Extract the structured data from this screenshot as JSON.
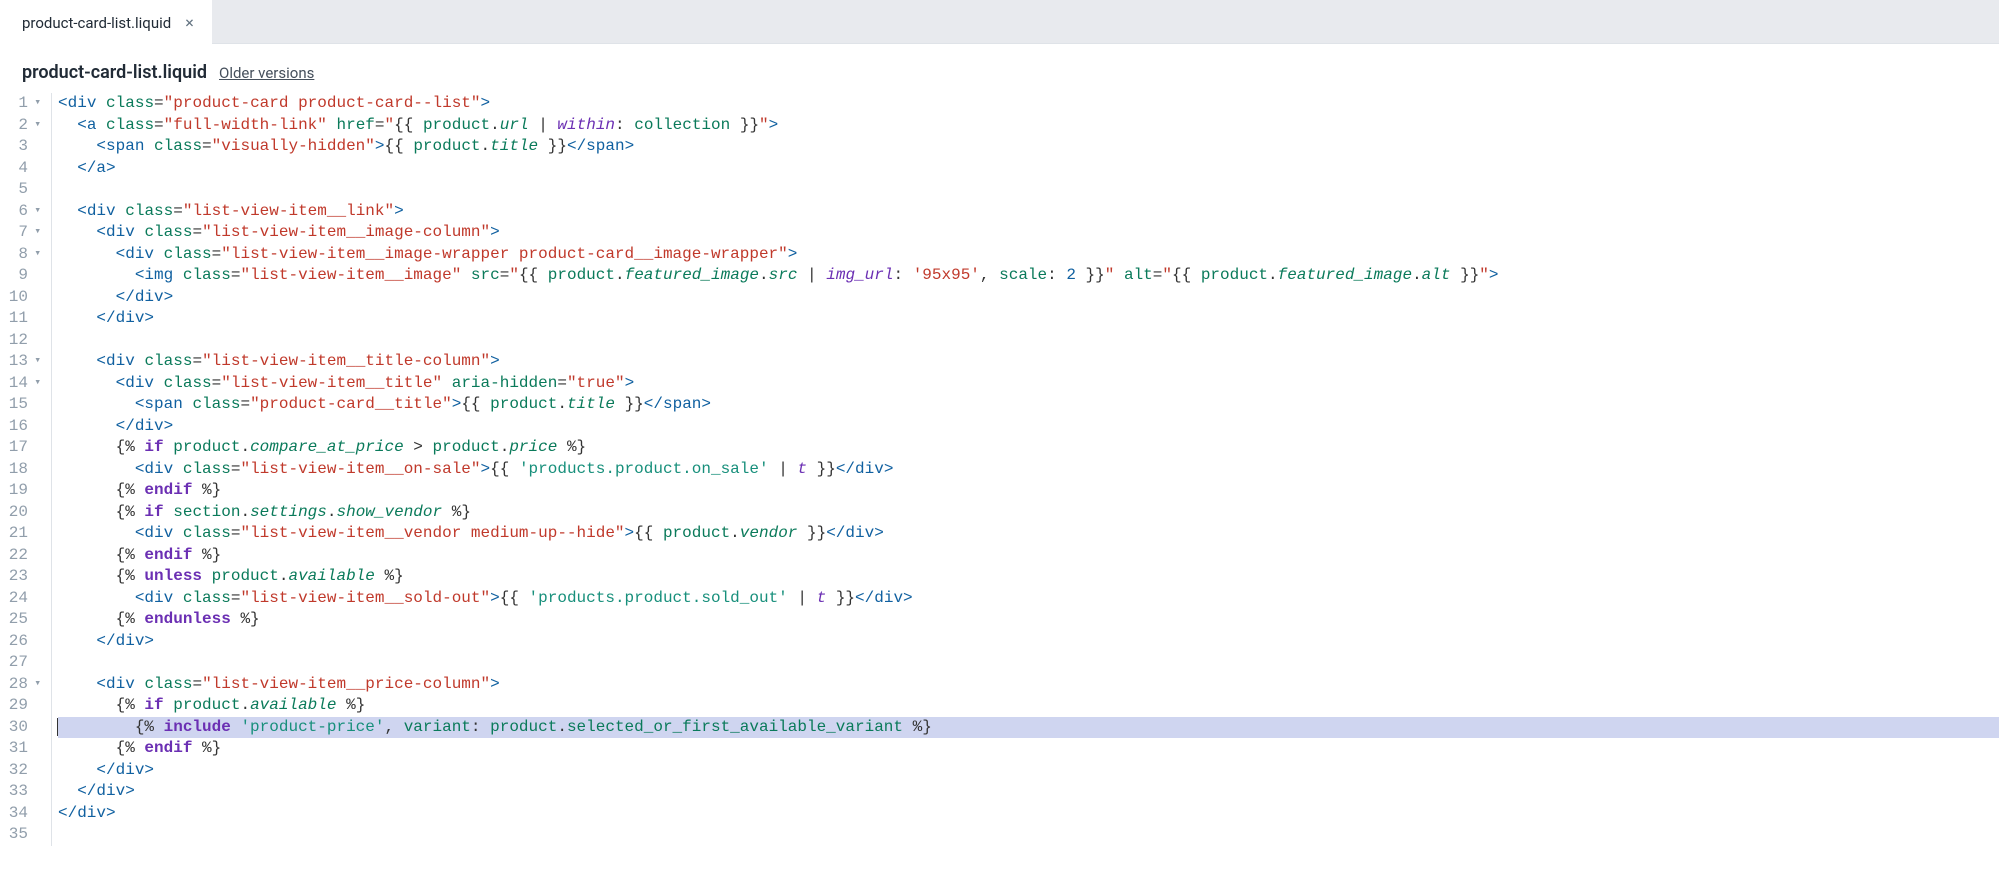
{
  "tab": {
    "label": "product-card-list.liquid"
  },
  "header": {
    "title": "product-card-list.liquid",
    "older": "Older versions"
  },
  "lines": [
    {
      "n": 1,
      "fold": "▾"
    },
    {
      "n": 2,
      "fold": "▾"
    },
    {
      "n": 3,
      "fold": ""
    },
    {
      "n": 4,
      "fold": ""
    },
    {
      "n": 5,
      "fold": ""
    },
    {
      "n": 6,
      "fold": "▾"
    },
    {
      "n": 7,
      "fold": "▾"
    },
    {
      "n": 8,
      "fold": "▾"
    },
    {
      "n": 9,
      "fold": ""
    },
    {
      "n": 10,
      "fold": ""
    },
    {
      "n": 11,
      "fold": ""
    },
    {
      "n": 12,
      "fold": ""
    },
    {
      "n": 13,
      "fold": "▾"
    },
    {
      "n": 14,
      "fold": "▾"
    },
    {
      "n": 15,
      "fold": ""
    },
    {
      "n": 16,
      "fold": ""
    },
    {
      "n": 17,
      "fold": ""
    },
    {
      "n": 18,
      "fold": ""
    },
    {
      "n": 19,
      "fold": ""
    },
    {
      "n": 20,
      "fold": ""
    },
    {
      "n": 21,
      "fold": ""
    },
    {
      "n": 22,
      "fold": ""
    },
    {
      "n": 23,
      "fold": ""
    },
    {
      "n": 24,
      "fold": ""
    },
    {
      "n": 25,
      "fold": ""
    },
    {
      "n": 26,
      "fold": ""
    },
    {
      "n": 27,
      "fold": ""
    },
    {
      "n": 28,
      "fold": "▾"
    },
    {
      "n": 29,
      "fold": ""
    },
    {
      "n": 30,
      "fold": ""
    },
    {
      "n": 31,
      "fold": ""
    },
    {
      "n": 32,
      "fold": ""
    },
    {
      "n": 33,
      "fold": ""
    },
    {
      "n": 34,
      "fold": ""
    },
    {
      "n": 35,
      "fold": ""
    }
  ],
  "code": {
    "l1": [
      [
        "<",
        "br"
      ],
      [
        "div",
        "tag"
      ],
      [
        " ",
        ""
      ],
      [
        "class",
        "attr"
      ],
      [
        "=",
        "eq"
      ],
      [
        "\"product-card product-card--list\"",
        "str"
      ],
      [
        ">",
        "br"
      ]
    ],
    "l2": [
      [
        "  ",
        ""
      ],
      [
        "<",
        "br"
      ],
      [
        "a",
        "tag"
      ],
      [
        " ",
        ""
      ],
      [
        "class",
        "attr"
      ],
      [
        "=",
        "eq"
      ],
      [
        "\"full-width-link\"",
        "str"
      ],
      [
        " ",
        ""
      ],
      [
        "href",
        "attr"
      ],
      [
        "=",
        "eq"
      ],
      [
        "\"",
        "str"
      ],
      [
        "{{ ",
        "ld"
      ],
      [
        "product",
        "var"
      ],
      [
        ".",
        "op"
      ],
      [
        "url",
        "prop"
      ],
      [
        " ",
        "pl"
      ],
      [
        "|",
        "pipe"
      ],
      [
        " ",
        "pl"
      ],
      [
        "within",
        "filt"
      ],
      [
        ": ",
        "pl"
      ],
      [
        "collection",
        "var"
      ],
      [
        " }}",
        "ld"
      ],
      [
        "\"",
        "str"
      ],
      [
        ">",
        "br"
      ]
    ],
    "l3": [
      [
        "    ",
        ""
      ],
      [
        "<",
        "br"
      ],
      [
        "span",
        "tag"
      ],
      [
        " ",
        ""
      ],
      [
        "class",
        "attr"
      ],
      [
        "=",
        "eq"
      ],
      [
        "\"visually-hidden\"",
        "str"
      ],
      [
        ">",
        "br"
      ],
      [
        "{{ ",
        "ld"
      ],
      [
        "product",
        "var"
      ],
      [
        ".",
        "op"
      ],
      [
        "title",
        "prop"
      ],
      [
        " }}",
        "ld"
      ],
      [
        "</",
        "br"
      ],
      [
        "span",
        "tag"
      ],
      [
        ">",
        "br"
      ]
    ],
    "l4": [
      [
        "  ",
        ""
      ],
      [
        "</",
        "br"
      ],
      [
        "a",
        "tag"
      ],
      [
        ">",
        "br"
      ]
    ],
    "l5": [
      [
        "",
        ""
      ]
    ],
    "l6": [
      [
        "  ",
        ""
      ],
      [
        "<",
        "br"
      ],
      [
        "div",
        "tag"
      ],
      [
        " ",
        ""
      ],
      [
        "class",
        "attr"
      ],
      [
        "=",
        "eq"
      ],
      [
        "\"list-view-item__link\"",
        "str"
      ],
      [
        ">",
        "br"
      ]
    ],
    "l7": [
      [
        "    ",
        ""
      ],
      [
        "<",
        "br"
      ],
      [
        "div",
        "tag"
      ],
      [
        " ",
        ""
      ],
      [
        "class",
        "attr"
      ],
      [
        "=",
        "eq"
      ],
      [
        "\"list-view-item__image-column\"",
        "str"
      ],
      [
        ">",
        "br"
      ]
    ],
    "l8": [
      [
        "      ",
        ""
      ],
      [
        "<",
        "br"
      ],
      [
        "div",
        "tag"
      ],
      [
        " ",
        ""
      ],
      [
        "class",
        "attr"
      ],
      [
        "=",
        "eq"
      ],
      [
        "\"list-view-item__image-wrapper product-card__image-wrapper\"",
        "str"
      ],
      [
        ">",
        "br"
      ]
    ],
    "l9": [
      [
        "        ",
        ""
      ],
      [
        "<",
        "br"
      ],
      [
        "img",
        "tag"
      ],
      [
        " ",
        ""
      ],
      [
        "class",
        "attr"
      ],
      [
        "=",
        "eq"
      ],
      [
        "\"list-view-item__image\"",
        "str"
      ],
      [
        " ",
        ""
      ],
      [
        "src",
        "attr"
      ],
      [
        "=",
        "eq"
      ],
      [
        "\"",
        "str"
      ],
      [
        "{{ ",
        "ld"
      ],
      [
        "product",
        "var"
      ],
      [
        ".",
        "op"
      ],
      [
        "featured_image",
        "prop"
      ],
      [
        ".",
        "op"
      ],
      [
        "src",
        "prop"
      ],
      [
        " ",
        "pl"
      ],
      [
        "|",
        "pipe"
      ],
      [
        " ",
        "pl"
      ],
      [
        "img_url",
        "filt"
      ],
      [
        ": ",
        "pl"
      ],
      [
        "'95x95'",
        "lstr2"
      ],
      [
        ", ",
        "pl"
      ],
      [
        "scale",
        "var"
      ],
      [
        ": ",
        "pl"
      ],
      [
        "2",
        "num"
      ],
      [
        " }}",
        "ld"
      ],
      [
        "\"",
        "str"
      ],
      [
        " ",
        ""
      ],
      [
        "alt",
        "attr"
      ],
      [
        "=",
        "eq"
      ],
      [
        "\"",
        "str"
      ],
      [
        "{{ ",
        "ld"
      ],
      [
        "product",
        "var"
      ],
      [
        ".",
        "op"
      ],
      [
        "featured_image",
        "prop"
      ],
      [
        ".",
        "op"
      ],
      [
        "alt",
        "prop"
      ],
      [
        " }}",
        "ld"
      ],
      [
        "\"",
        "str"
      ],
      [
        ">",
        "br"
      ]
    ],
    "l10": [
      [
        "      ",
        ""
      ],
      [
        "</",
        "br"
      ],
      [
        "div",
        "tag"
      ],
      [
        ">",
        "br"
      ]
    ],
    "l11": [
      [
        "    ",
        ""
      ],
      [
        "</",
        "br"
      ],
      [
        "div",
        "tag"
      ],
      [
        ">",
        "br"
      ]
    ],
    "l12": [
      [
        "",
        ""
      ]
    ],
    "l13": [
      [
        "    ",
        ""
      ],
      [
        "<",
        "br"
      ],
      [
        "div",
        "tag"
      ],
      [
        " ",
        ""
      ],
      [
        "class",
        "attr"
      ],
      [
        "=",
        "eq"
      ],
      [
        "\"list-view-item__title-column\"",
        "str"
      ],
      [
        ">",
        "br"
      ]
    ],
    "l14": [
      [
        "      ",
        ""
      ],
      [
        "<",
        "br"
      ],
      [
        "div",
        "tag"
      ],
      [
        " ",
        ""
      ],
      [
        "class",
        "attr"
      ],
      [
        "=",
        "eq"
      ],
      [
        "\"list-view-item__title\"",
        "str"
      ],
      [
        " ",
        ""
      ],
      [
        "aria-hidden",
        "attr"
      ],
      [
        "=",
        "eq"
      ],
      [
        "\"true\"",
        "str"
      ],
      [
        ">",
        "br"
      ]
    ],
    "l15": [
      [
        "        ",
        ""
      ],
      [
        "<",
        "br"
      ],
      [
        "span",
        "tag"
      ],
      [
        " ",
        ""
      ],
      [
        "class",
        "attr"
      ],
      [
        "=",
        "eq"
      ],
      [
        "\"product-card__title\"",
        "str"
      ],
      [
        ">",
        "br"
      ],
      [
        "{{ ",
        "ld"
      ],
      [
        "product",
        "var"
      ],
      [
        ".",
        "op"
      ],
      [
        "title",
        "prop"
      ],
      [
        " }}",
        "ld"
      ],
      [
        "</",
        "br"
      ],
      [
        "span",
        "tag"
      ],
      [
        ">",
        "br"
      ]
    ],
    "l16": [
      [
        "      ",
        ""
      ],
      [
        "</",
        "br"
      ],
      [
        "div",
        "tag"
      ],
      [
        ">",
        "br"
      ]
    ],
    "l17": [
      [
        "      ",
        ""
      ],
      [
        "{% ",
        "ld"
      ],
      [
        "if",
        "kw"
      ],
      [
        " ",
        "pl"
      ],
      [
        "product",
        "var"
      ],
      [
        ".",
        "op"
      ],
      [
        "compare_at_price",
        "prop"
      ],
      [
        " > ",
        "op"
      ],
      [
        "product",
        "var"
      ],
      [
        ".",
        "op"
      ],
      [
        "price",
        "prop"
      ],
      [
        " %}",
        "ld"
      ]
    ],
    "l18": [
      [
        "        ",
        ""
      ],
      [
        "<",
        "br"
      ],
      [
        "div",
        "tag"
      ],
      [
        " ",
        ""
      ],
      [
        "class",
        "attr"
      ],
      [
        "=",
        "eq"
      ],
      [
        "\"list-view-item__on-sale\"",
        "str"
      ],
      [
        ">",
        "br"
      ],
      [
        "{{ ",
        "ld"
      ],
      [
        "'products.product.on_sale'",
        "lstr"
      ],
      [
        " ",
        "pl"
      ],
      [
        "|",
        "pipe"
      ],
      [
        " ",
        "pl"
      ],
      [
        "t",
        "filt"
      ],
      [
        " }}",
        "ld"
      ],
      [
        "</",
        "br"
      ],
      [
        "div",
        "tag"
      ],
      [
        ">",
        "br"
      ]
    ],
    "l19": [
      [
        "      ",
        ""
      ],
      [
        "{% ",
        "ld"
      ],
      [
        "endif",
        "kw"
      ],
      [
        " %}",
        "ld"
      ]
    ],
    "l20": [
      [
        "      ",
        ""
      ],
      [
        "{% ",
        "ld"
      ],
      [
        "if",
        "kw"
      ],
      [
        " ",
        "pl"
      ],
      [
        "section",
        "var"
      ],
      [
        ".",
        "op"
      ],
      [
        "settings",
        "prop"
      ],
      [
        ".",
        "op"
      ],
      [
        "show_vendor",
        "prop"
      ],
      [
        " %}",
        "ld"
      ]
    ],
    "l21": [
      [
        "        ",
        ""
      ],
      [
        "<",
        "br"
      ],
      [
        "div",
        "tag"
      ],
      [
        " ",
        ""
      ],
      [
        "class",
        "attr"
      ],
      [
        "=",
        "eq"
      ],
      [
        "\"list-view-item__vendor medium-up--hide\"",
        "str"
      ],
      [
        ">",
        "br"
      ],
      [
        "{{ ",
        "ld"
      ],
      [
        "product",
        "var"
      ],
      [
        ".",
        "op"
      ],
      [
        "vendor",
        "prop"
      ],
      [
        " }}",
        "ld"
      ],
      [
        "</",
        "br"
      ],
      [
        "div",
        "tag"
      ],
      [
        ">",
        "br"
      ]
    ],
    "l22": [
      [
        "      ",
        ""
      ],
      [
        "{% ",
        "ld"
      ],
      [
        "endif",
        "kw"
      ],
      [
        " %}",
        "ld"
      ]
    ],
    "l23": [
      [
        "      ",
        ""
      ],
      [
        "{% ",
        "ld"
      ],
      [
        "unless",
        "kw"
      ],
      [
        " ",
        "pl"
      ],
      [
        "product",
        "var"
      ],
      [
        ".",
        "op"
      ],
      [
        "available",
        "prop"
      ],
      [
        " %}",
        "ld"
      ]
    ],
    "l24": [
      [
        "        ",
        ""
      ],
      [
        "<",
        "br"
      ],
      [
        "div",
        "tag"
      ],
      [
        " ",
        ""
      ],
      [
        "class",
        "attr"
      ],
      [
        "=",
        "eq"
      ],
      [
        "\"list-view-item__sold-out\"",
        "str"
      ],
      [
        ">",
        "br"
      ],
      [
        "{{ ",
        "ld"
      ],
      [
        "'products.product.sold_out'",
        "lstr"
      ],
      [
        " ",
        "pl"
      ],
      [
        "|",
        "pipe"
      ],
      [
        " ",
        "pl"
      ],
      [
        "t",
        "filt"
      ],
      [
        " }}",
        "ld"
      ],
      [
        "</",
        "br"
      ],
      [
        "div",
        "tag"
      ],
      [
        ">",
        "br"
      ]
    ],
    "l25": [
      [
        "      ",
        ""
      ],
      [
        "{% ",
        "ld"
      ],
      [
        "endunless",
        "kw"
      ],
      [
        " %}",
        "ld"
      ]
    ],
    "l26": [
      [
        "    ",
        ""
      ],
      [
        "</",
        "br"
      ],
      [
        "div",
        "tag"
      ],
      [
        ">",
        "br"
      ]
    ],
    "l27": [
      [
        "",
        ""
      ]
    ],
    "l28": [
      [
        "    ",
        ""
      ],
      [
        "<",
        "br"
      ],
      [
        "div",
        "tag"
      ],
      [
        " ",
        ""
      ],
      [
        "class",
        "attr"
      ],
      [
        "=",
        "eq"
      ],
      [
        "\"list-view-item__price-column\"",
        "str"
      ],
      [
        ">",
        "br"
      ]
    ],
    "l29": [
      [
        "      ",
        ""
      ],
      [
        "{% ",
        "ld"
      ],
      [
        "if",
        "kw"
      ],
      [
        " ",
        "pl"
      ],
      [
        "product",
        "var"
      ],
      [
        ".",
        "op"
      ],
      [
        "available",
        "prop"
      ],
      [
        " %}",
        "ld"
      ]
    ],
    "l30": [
      [
        "        ",
        ""
      ],
      [
        "{% ",
        "ld"
      ],
      [
        "include",
        "kw"
      ],
      [
        " ",
        "pl"
      ],
      [
        "'product-price'",
        "lstr"
      ],
      [
        ", ",
        "pl"
      ],
      [
        "variant",
        "var"
      ],
      [
        ": ",
        "pl"
      ],
      [
        "product",
        "var"
      ],
      [
        ".",
        "op"
      ],
      [
        "selected_or_first_available_variant",
        "var"
      ],
      [
        " %}",
        "ld"
      ]
    ],
    "l31": [
      [
        "      ",
        ""
      ],
      [
        "{% ",
        "ld"
      ],
      [
        "endif",
        "kw"
      ],
      [
        " %}",
        "ld"
      ]
    ],
    "l32": [
      [
        "    ",
        ""
      ],
      [
        "</",
        "br"
      ],
      [
        "div",
        "tag"
      ],
      [
        ">",
        "br"
      ]
    ],
    "l33": [
      [
        "  ",
        ""
      ],
      [
        "</",
        "br"
      ],
      [
        "div",
        "tag"
      ],
      [
        ">",
        "br"
      ]
    ],
    "l34": [
      [
        "</",
        "br"
      ],
      [
        "div",
        "tag"
      ],
      [
        ">",
        "br"
      ]
    ],
    "l35": [
      [
        "",
        ""
      ]
    ]
  },
  "highlight_line": 30
}
